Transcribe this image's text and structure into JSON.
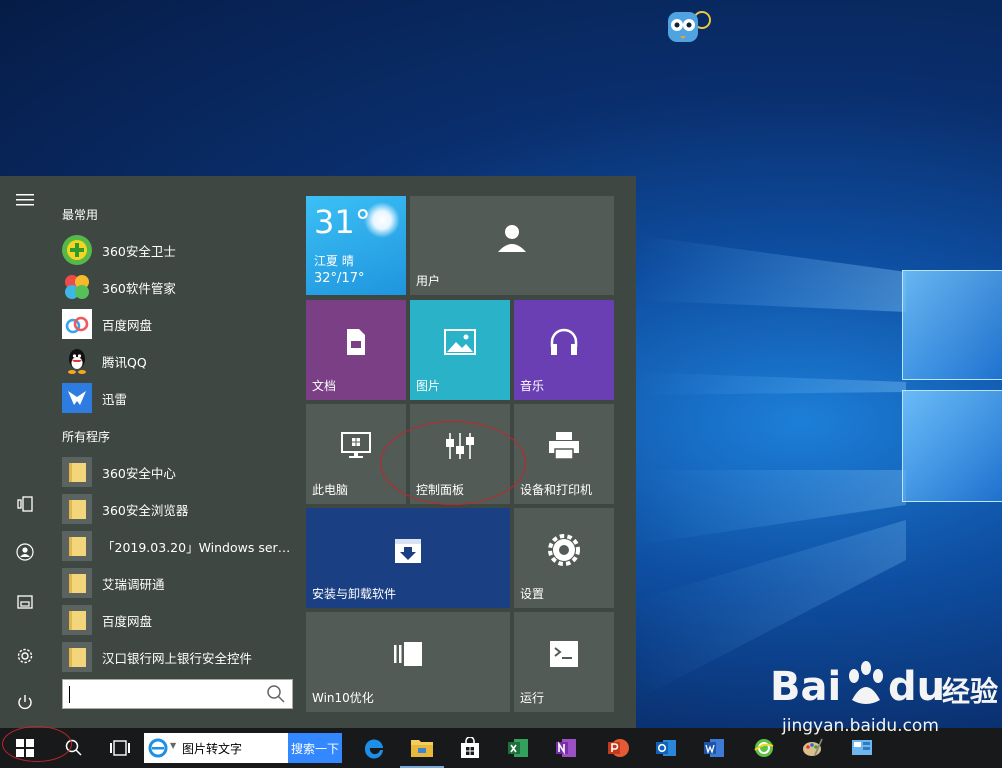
{
  "start_menu": {
    "most_used_title": "最常用",
    "all_programs_title": "所有程序",
    "most_used": [
      {
        "label": "360安全卫士",
        "icon": "360-safe-icon"
      },
      {
        "label": "360软件管家",
        "icon": "360-software-manager-icon"
      },
      {
        "label": "百度网盘",
        "icon": "baidu-netdisk-icon"
      },
      {
        "label": "腾讯QQ",
        "icon": "qq-penguin-icon"
      },
      {
        "label": "迅雷",
        "icon": "xunlei-bird-icon"
      }
    ],
    "all_programs": [
      {
        "label": "360安全中心"
      },
      {
        "label": "360安全浏览器"
      },
      {
        "label": "「2019.03.20」Windows server..."
      },
      {
        "label": "艾瑞调研通"
      },
      {
        "label": "百度网盘"
      },
      {
        "label": "汉口银行网上银行安全控件"
      }
    ],
    "search_value": ""
  },
  "tiles": {
    "weather": {
      "temp": "31°",
      "location": "江夏 晴",
      "range": "32°/17°"
    },
    "user": "用户",
    "documents": "文档",
    "pictures": "图片",
    "music": "音乐",
    "this_pc": "此电脑",
    "control_panel": "控制面板",
    "devices_printers": "设备和打印机",
    "install_uninstall": "安装与卸载软件",
    "settings": "设置",
    "win10_optimize": "Win10优化",
    "run": "运行"
  },
  "taskbar": {
    "search_text": "图片转文字",
    "search_button": "搜索一下"
  },
  "watermark": {
    "brand": "Bai",
    "brand_suffix": "du",
    "brand_cn": "经验",
    "url": "jingyan.baidu.com"
  },
  "colors": {
    "start_bg": "#3f4742",
    "tile_gray": "#535b56",
    "weather_blue": "#2aa8ea",
    "documents_purple": "#7b3f86",
    "pictures_teal": "#2ab3c8",
    "music_purple": "#6b3fb4",
    "install_blue": "#1b3f83",
    "annotation_red": "#c0262b",
    "taskbar_bg": "#18191b"
  }
}
